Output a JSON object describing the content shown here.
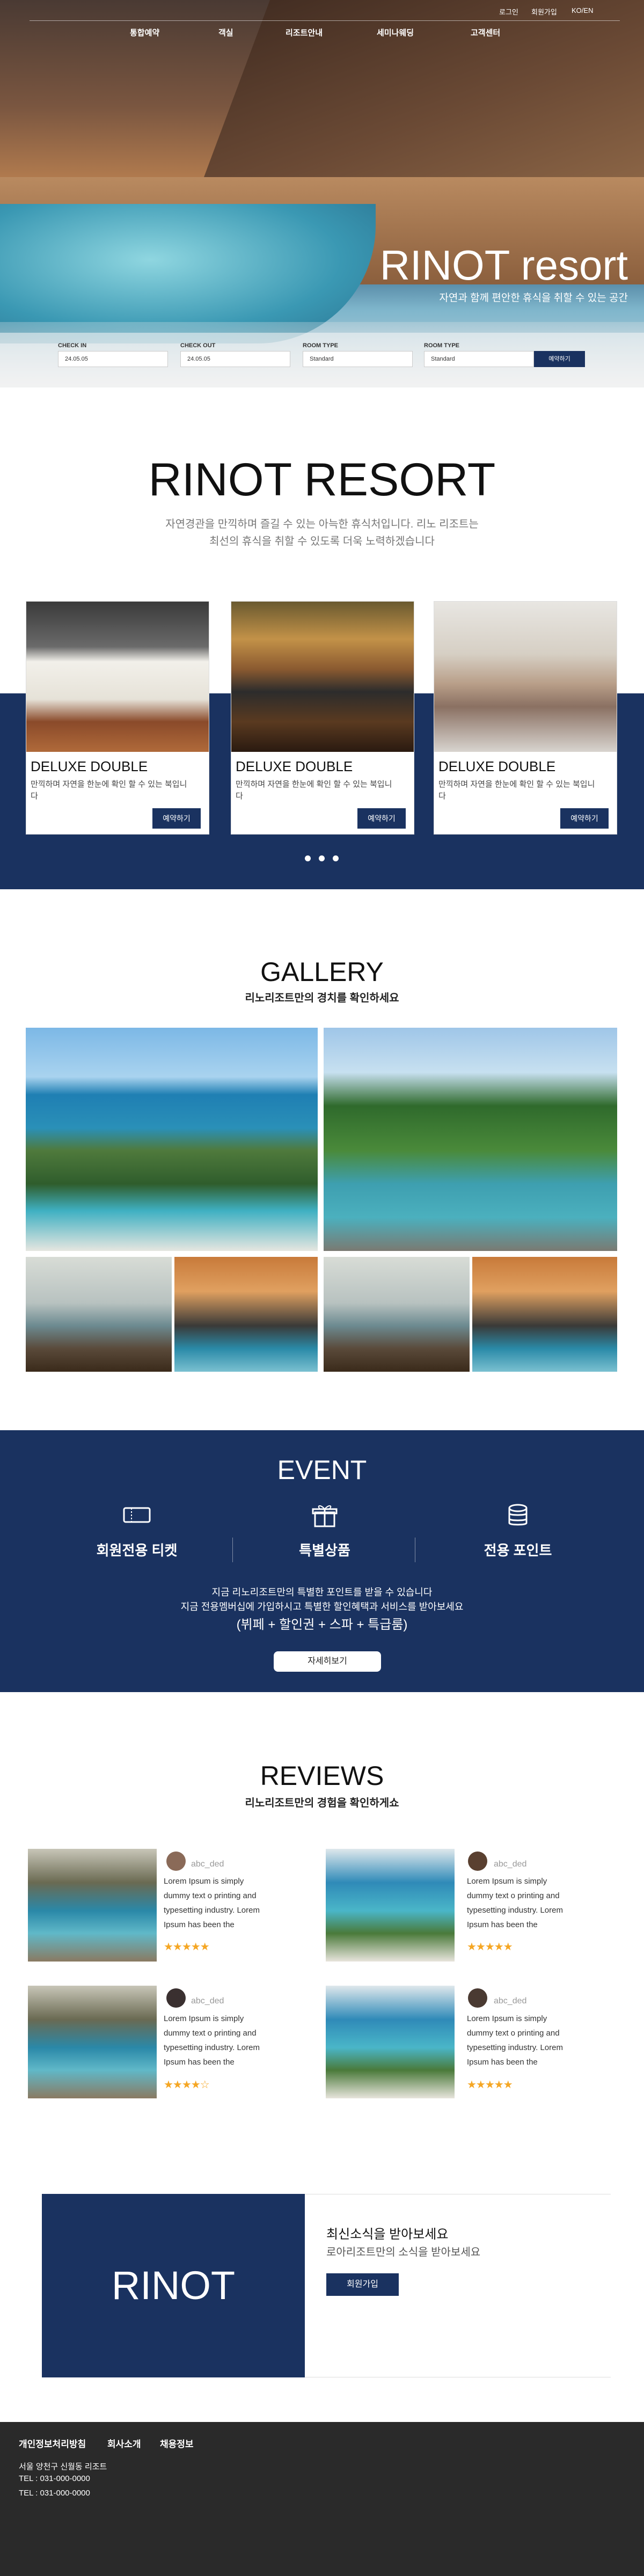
{
  "colors": {
    "navy": "#1a3260",
    "star": "#f5a623",
    "footer": "#2a2a2a"
  },
  "topbar": {
    "login": "로그인",
    "signup": "회원가입",
    "lang": "KO/EN"
  },
  "nav": {
    "items": [
      "통합예약",
      "객실",
      "리조트안내",
      "세미나웨딩",
      "고객센터"
    ]
  },
  "hero": {
    "title": "RINOT resort",
    "subtitle": "자연과 함께 편안한 휴식을 취할 수 있는 공간"
  },
  "booking": {
    "checkin_label": "CHECK IN",
    "checkin_value": "24.05.05",
    "checkout_label": "CHECK OUT",
    "checkout_value": "24.05.05",
    "roomtype1_label": "ROOM TYPE",
    "roomtype1_value": "Standard",
    "roomtype2_label": "ROOM TYPE",
    "roomtype2_value": "Standard",
    "button": "예약하기"
  },
  "resort": {
    "title": "RINOT RESORT",
    "desc1": "자연경관을 만끽하며 즐길 수 있는 아늑한 휴식처입니다. 리노 리조트는",
    "desc2": "최선의 휴식을 취할 수 있도록 더욱 노력하겠습니다"
  },
  "rooms": [
    {
      "name": "DELUXE DOUBLE",
      "desc": "만끽하며 자연을 한눈에 확인 할 수 있는 북입니다",
      "button": "예약하기"
    },
    {
      "name": "DELUXE DOUBLE",
      "desc": "만끽하며 자연을 한눈에 확인 할 수 있는 북입니다",
      "button": "예약하기"
    },
    {
      "name": "DELUXE DOUBLE",
      "desc": "만끽하며 자연을 한눈에 확인 할 수 있는 북입니다",
      "button": "예약하기"
    }
  ],
  "gallery": {
    "title": "GALLERY",
    "subtitle": "리노리조트만의 경치를 확인하세요"
  },
  "event": {
    "title": "EVENT",
    "items": [
      {
        "label": "회원전용 티켓",
        "icon": "ticket-icon"
      },
      {
        "label": "특별상품",
        "icon": "gift-icon"
      },
      {
        "label": "전용 포인트",
        "icon": "coins-icon"
      }
    ],
    "desc1": "지금 리노리조트만의 특별한 포인트를 받을 수 있습니다",
    "desc2": "지금 전용멤버십에 가입하시고 특별한 할인혜택과 서비스를 받아보세요",
    "desc3": "(뷔페 + 할인권 + 스파 + 특급룸)",
    "button": "자세히보기"
  },
  "reviews": {
    "title": "REVIEWS",
    "subtitle": "리노리조트만의 경험을 확인하게쇼",
    "items": [
      {
        "user": "abc_ded",
        "text": "Lorem Ipsum is simply dummy text o printing and typesetting industry. Lorem Ipsum has been the industry's standa rd dummy text ever since the",
        "rating": 5
      },
      {
        "user": "abc_ded",
        "text": "Lorem Ipsum is simply dummy text o printing and typesetting industry. Lorem Ipsum has been the industry's standa rd dummy text ever since the",
        "rating": 5
      },
      {
        "user": "abc_ded",
        "text": "Lorem Ipsum is simply dummy text o printing and typesetting industry. Lorem Ipsum has been the industry's standa rd dummy text ever since the",
        "rating": 4
      },
      {
        "user": "abc_ded",
        "text": "Lorem Ipsum is simply dummy text o printing and typesetting industry. Lorem Ipsum has been the industry's standa rd dummy text ever since the",
        "rating": 5
      }
    ],
    "stars": {
      "five": "★★★★★",
      "four": "★★★★☆"
    }
  },
  "newsletter": {
    "logo": "RINOT",
    "title": "최신소식을 받아보세요",
    "subtitle": "로아리조트만의 소식을 받아보세요",
    "button": "회원가입"
  },
  "footer": {
    "links": [
      "개인정보처리방침",
      "회사소개",
      "채용정보"
    ],
    "address": "서울 양천구 신월동 리조트",
    "tel1": "TEL : 031-000-0000",
    "tel2": "TEL : 031-000-0000"
  }
}
